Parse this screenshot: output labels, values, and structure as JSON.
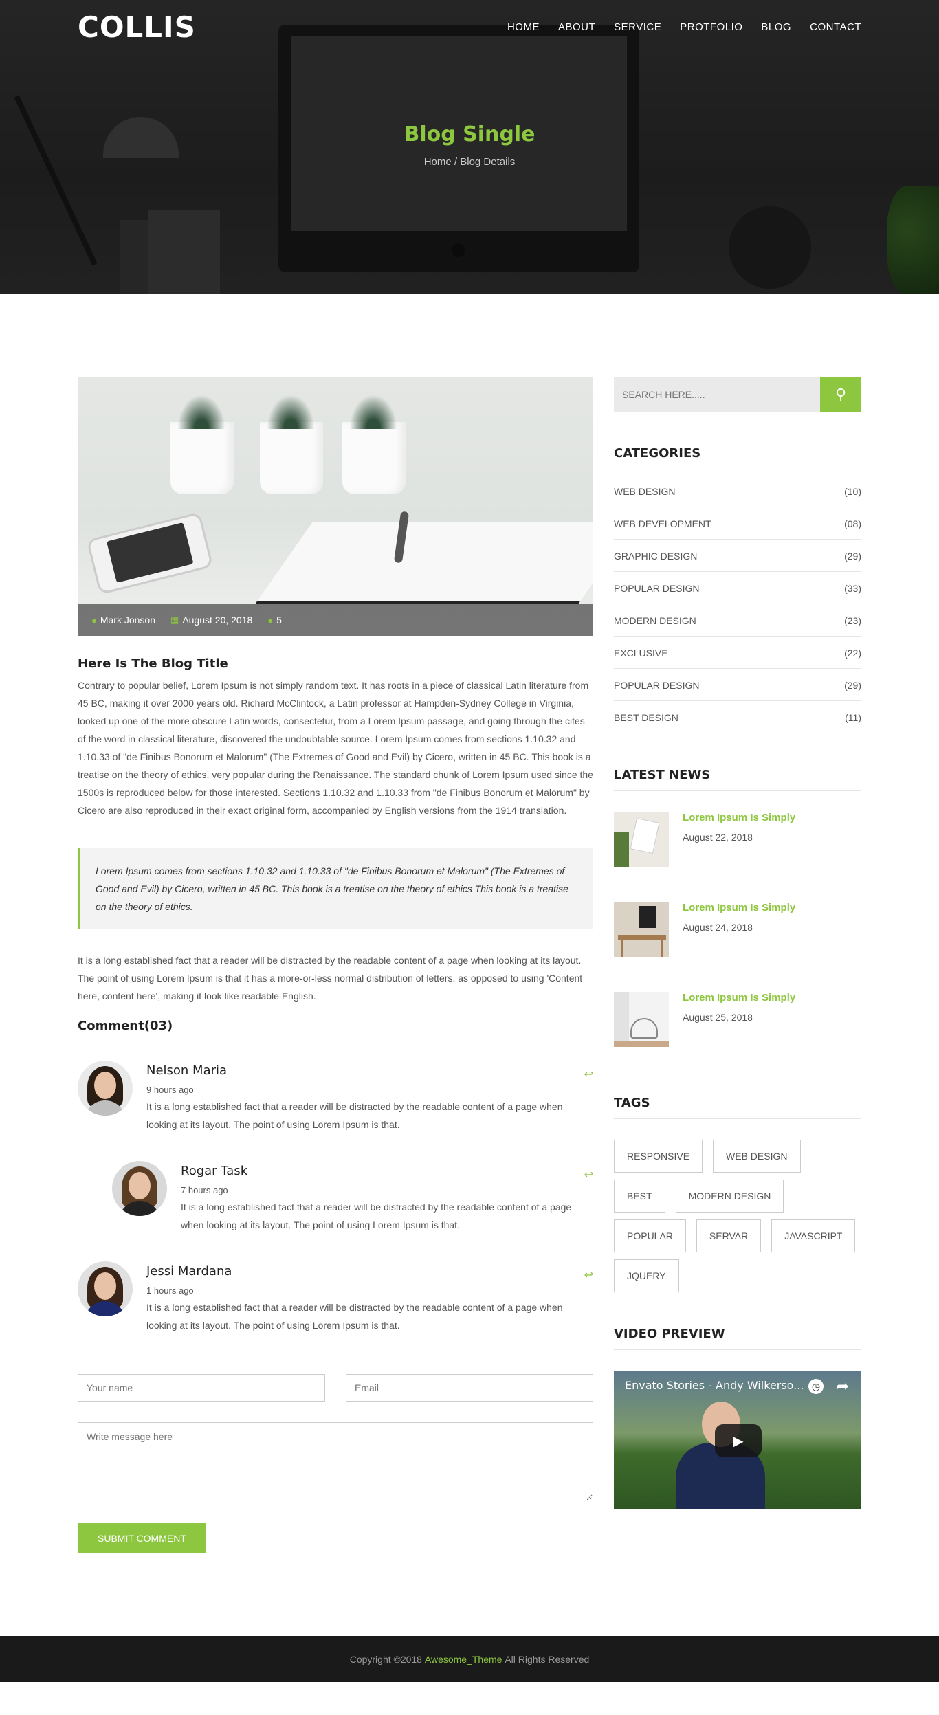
{
  "header": {
    "logo": "COLLIS",
    "menu": [
      "HOME",
      "ABOUT",
      "SERVICE",
      "PROTFOLIO",
      "BLOG",
      "CONTACT"
    ],
    "title": "Blog Single",
    "breadcrumb": "Home / Blog Details"
  },
  "post": {
    "author": "Mark Jonson",
    "date": "August 20, 2018",
    "comments_count": "5",
    "title": "Here Is The Blog Title",
    "body": "Contrary to popular belief, Lorem Ipsum is not simply random text. It has roots in a piece of classical Latin literature from 45 BC, making it over 2000 years old. Richard McClintock, a Latin professor at Hampden-Sydney College in Virginia, looked up one of the more obscure Latin words, consectetur, from a Lorem Ipsum passage, and going through the cites of the word in classical literature, discovered the undoubtable source. Lorem Ipsum comes from sections 1.10.32 and 1.10.33 of \"de Finibus Bonorum et Malorum\" (The Extremes of Good and Evil) by Cicero, written in 45 BC. This book is a treatise on the theory of ethics, very popular during the Renaissance. The standard chunk of Lorem Ipsum used since the 1500s is reproduced below for those interested. Sections 1.10.32 and 1.10.33 from \"de Finibus Bonorum et Malorum\" by Cicero are also reproduced in their exact original form, accompanied by English versions from the 1914 translation.",
    "quote": "Lorem Ipsum comes from sections 1.10.32 and 1.10.33 of \"de Finibus Bonorum et Malorum\" (The Extremes of Good and Evil) by Cicero, written in 45 BC. This book is a treatise on the theory of ethics This book is a treatise on the theory of ethics.",
    "body2": "It is a long established fact that a reader will be distracted by the readable content of a page when looking at its layout. The point of using Lorem Ipsum is that it has a more-or-less normal distribution of letters, as opposed to using 'Content here, content here', making it look like readable English."
  },
  "comments": {
    "title": "Comment(03)",
    "items": [
      {
        "name": "Nelson Maria",
        "time": "9 hours ago",
        "text": "It is a long established fact that a reader will be distracted by the readable content of a page when looking at its layout. The point of using Lorem Ipsum is that."
      },
      {
        "name": "Rogar Task",
        "time": "7 hours ago",
        "text": "It is a long established fact that a reader will be distracted by the readable content of a page when looking at its layout. The point of using Lorem Ipsum is that."
      },
      {
        "name": "Jessi Mardana",
        "time": "1 hours ago",
        "text": "It is a long established fact that a reader will be distracted by the readable content of a page when looking at its layout. The point of using Lorem Ipsum is that."
      }
    ]
  },
  "form": {
    "name_placeholder": "Your name",
    "email_placeholder": "Email",
    "message_placeholder": "Write message here",
    "submit_label": "SUBMIT COMMENT"
  },
  "sidebar": {
    "search_placeholder": "SEARCH HERE.....",
    "categories_title": "CATEGORIES",
    "categories": [
      {
        "name": "WEB DESIGN",
        "count": "(10)"
      },
      {
        "name": "WEB DEVELOPMENT",
        "count": "(08)"
      },
      {
        "name": "GRAPHIC DESIGN",
        "count": "(29)"
      },
      {
        "name": "POPULAR DESIGN",
        "count": "(33)"
      },
      {
        "name": "MODERN DESIGN",
        "count": "(23)"
      },
      {
        "name": "EXCLUSIVE",
        "count": "(22)"
      },
      {
        "name": "POPULAR DESIGN",
        "count": "(29)"
      },
      {
        "name": "BEST DESIGN",
        "count": "(11)"
      }
    ],
    "news_title": "LATEST NEWS",
    "news": [
      {
        "title": "Lorem Ipsum Is Simply",
        "date": "August 22, 2018"
      },
      {
        "title": "Lorem Ipsum Is Simply",
        "date": "August 24, 2018"
      },
      {
        "title": "Lorem Ipsum Is Simply",
        "date": "August 25, 2018"
      }
    ],
    "tags_title": "TAGS",
    "tags": [
      "RESPONSIVE",
      "WEB DESIGN",
      "BEST",
      "MODERN DESIGN",
      "POPULAR",
      "SERVAR",
      "JAVASCRIPT",
      "JQUERY"
    ],
    "video_title": "VIDEO PREVIEW",
    "video_caption": "Envato Stories - Andy Wilkerso..."
  },
  "footer": {
    "prefix": "Copyright ©2018",
    "brand": "Awesome_Theme",
    "suffix": "All Rights Reserved"
  },
  "colors": {
    "accent": "#8dc63f",
    "dark": "#1a1a1a"
  }
}
